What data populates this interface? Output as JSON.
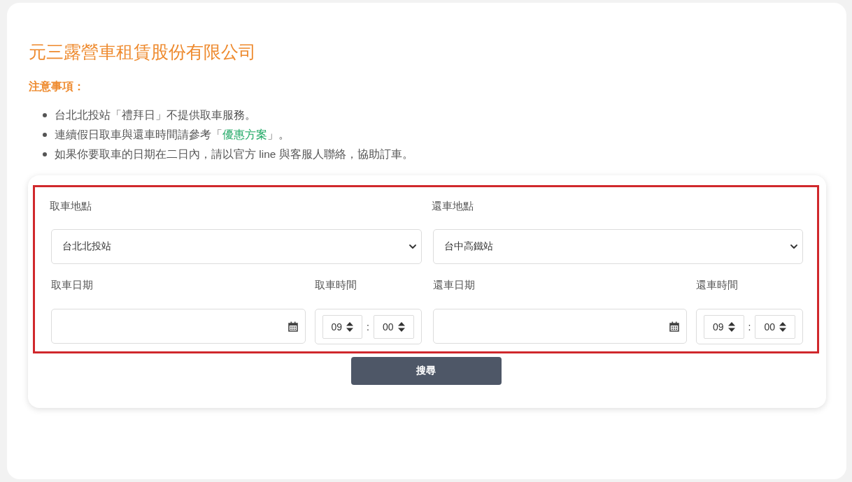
{
  "company_title": "元三露營車租賃股份有限公司",
  "notice": {
    "heading": "注意事項：",
    "items": [
      {
        "segments": [
          {
            "kind": "text",
            "text": "台北北投站「禮拜日」不提供取車服務。"
          }
        ]
      },
      {
        "segments": [
          {
            "kind": "text",
            "text": "連續假日取車與還車時間請參考「"
          },
          {
            "kind": "link",
            "text": "優惠方案"
          },
          {
            "kind": "text",
            "text": "」。"
          }
        ]
      },
      {
        "segments": [
          {
            "kind": "text",
            "text": "如果你要取車的日期在二日內，請以官方 line 與客服人聯絡，協助訂車。"
          }
        ]
      }
    ]
  },
  "search_form": {
    "highlighted": true,
    "legs": [
      {
        "location_label": "取車地點",
        "location": "台北北投站",
        "date_label": "取車日期",
        "time_label": "取車時間",
        "hour": "09",
        "separator": ":",
        "minute": "00"
      },
      {
        "location_label": "還車地點",
        "location": "台中高鐵站",
        "date_label": "還車日期",
        "time_label": "還車時間",
        "hour": "09",
        "separator": ":",
        "minute": "00"
      }
    ],
    "search_button": "搜尋"
  }
}
